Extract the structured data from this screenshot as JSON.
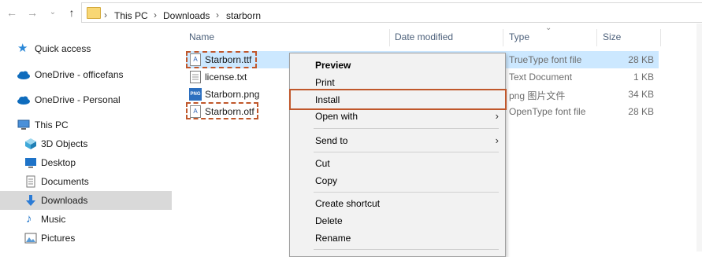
{
  "breadcrumb": {
    "this_pc": "This PC",
    "downloads": "Downloads",
    "current": "starborn"
  },
  "sidebar": {
    "items": [
      {
        "label": "Quick access",
        "icon": "star-icon"
      },
      {
        "label": "OneDrive - officefans",
        "icon": "cloud-icon"
      },
      {
        "label": "OneDrive - Personal",
        "icon": "cloud-icon"
      },
      {
        "label": "This PC",
        "icon": "computer-icon"
      },
      {
        "label": "3D Objects",
        "icon": "cube-icon"
      },
      {
        "label": "Desktop",
        "icon": "desktop-icon"
      },
      {
        "label": "Documents",
        "icon": "documents-icon"
      },
      {
        "label": "Downloads",
        "icon": "download-arrow-icon",
        "selected": true
      },
      {
        "label": "Music",
        "icon": "music-note-icon"
      },
      {
        "label": "Pictures",
        "icon": "pictures-icon"
      }
    ]
  },
  "columns": {
    "name": "Name",
    "date": "Date modified",
    "type": "Type",
    "size": "Size"
  },
  "files": [
    {
      "name": "Starborn.ttf",
      "type": "TrueType font file",
      "size": "28 KB",
      "icon": "font-file-icon",
      "selected": true
    },
    {
      "name": "license.txt",
      "type": "Text Document",
      "size": "1 KB",
      "icon": "text-file-icon"
    },
    {
      "name": "Starborn.png",
      "type": "png 图片文件",
      "size": "34 KB",
      "icon": "png-file-icon"
    },
    {
      "name": "Starborn.otf",
      "type": "OpenType font file",
      "size": "28 KB",
      "icon": "font-file-icon"
    }
  ],
  "context_menu": {
    "preview": "Preview",
    "print": "Print",
    "install": "Install",
    "open_with": "Open with",
    "send_to": "Send to",
    "cut": "Cut",
    "copy": "Copy",
    "create_shortcut": "Create shortcut",
    "delete": "Delete",
    "rename": "Rename"
  },
  "colors": {
    "selection": "#cce8ff",
    "highlight": "#c0572b",
    "sidebar_selected": "#d9d9d9"
  }
}
